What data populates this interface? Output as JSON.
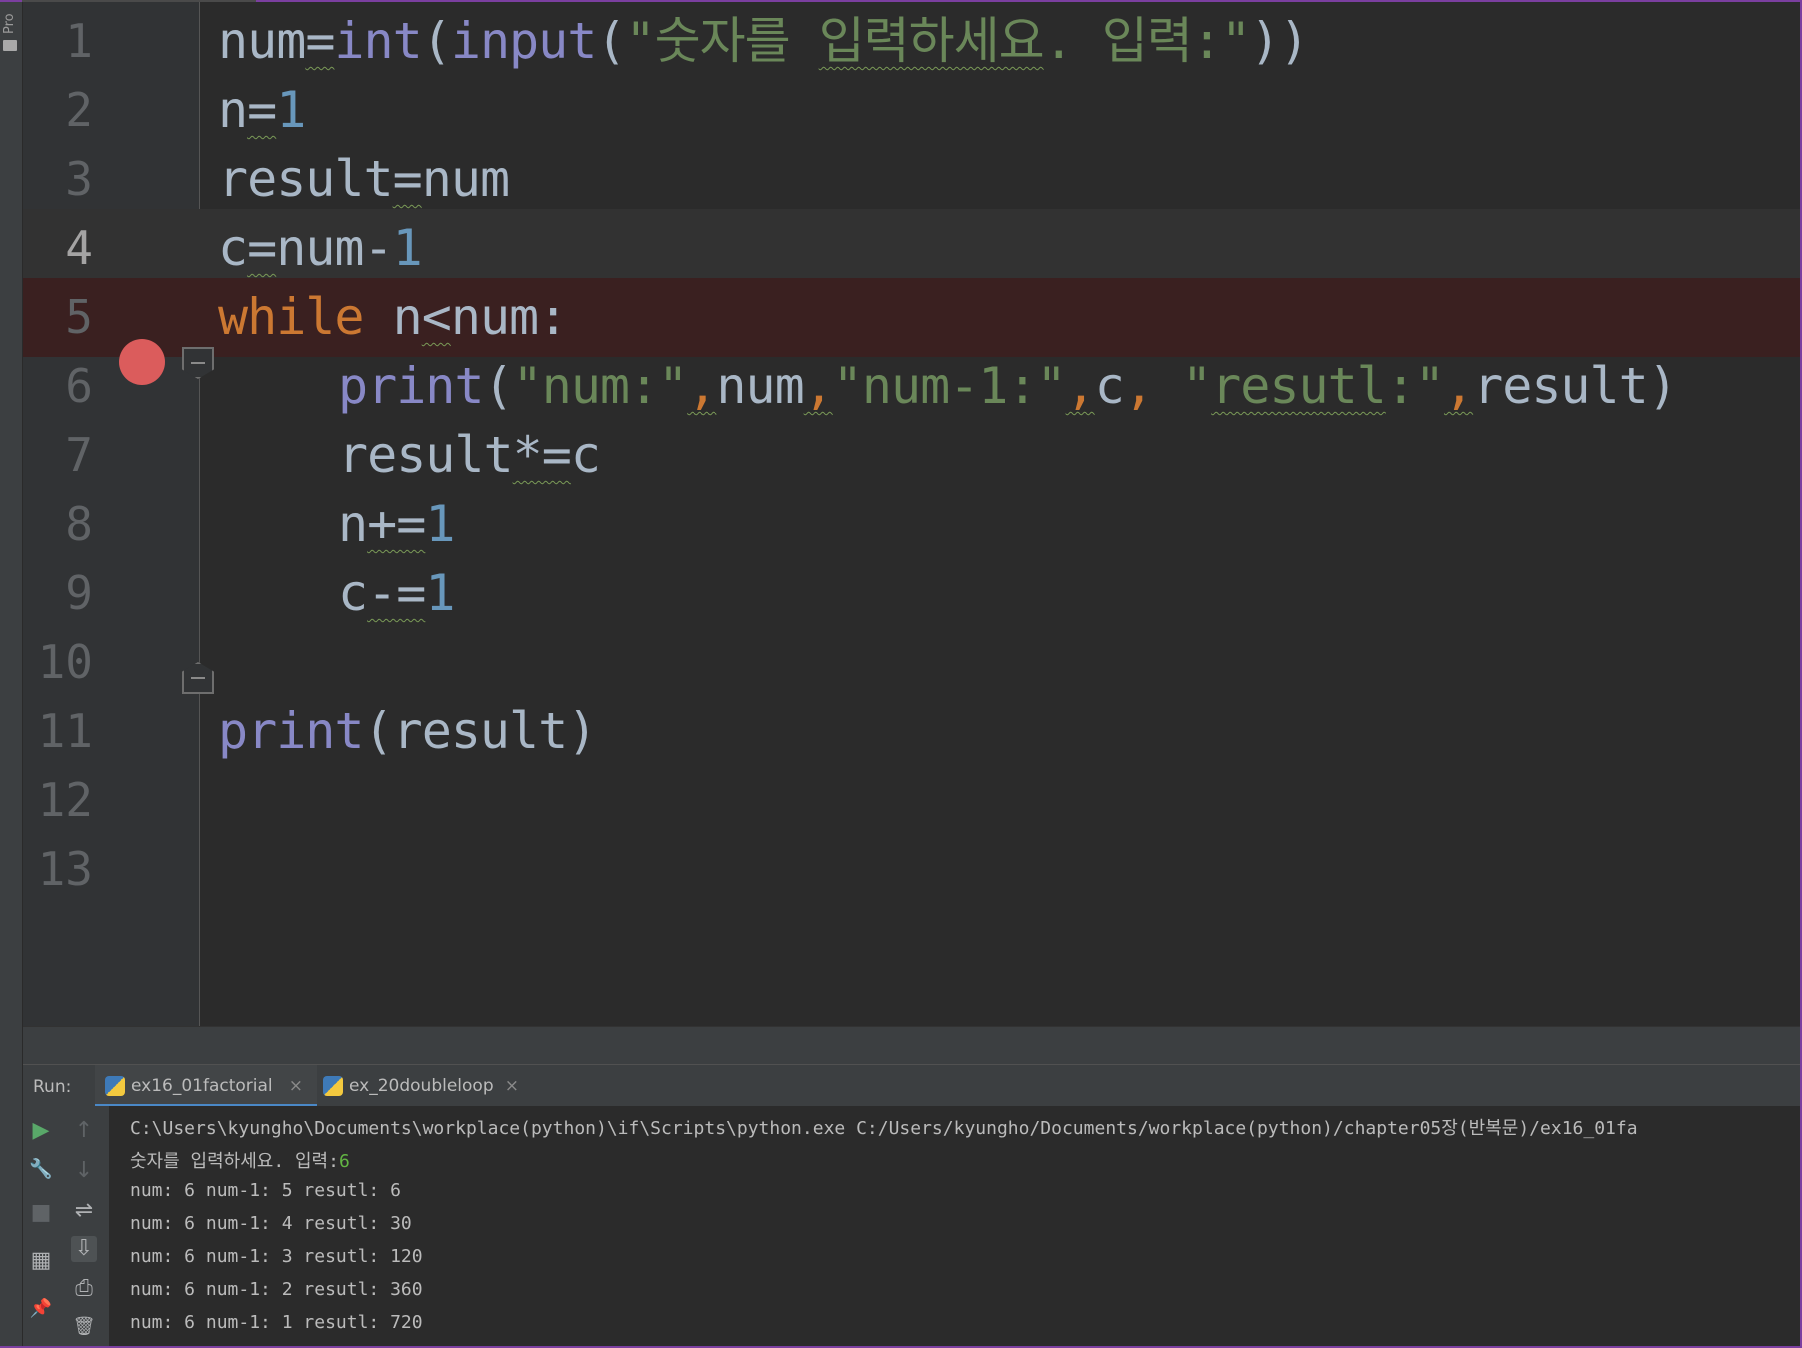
{
  "sidebar": {
    "project_label": "Pro"
  },
  "editor": {
    "lines": [
      {
        "n": "1"
      },
      {
        "n": "2"
      },
      {
        "n": "3"
      },
      {
        "n": "4"
      },
      {
        "n": "5"
      },
      {
        "n": "6"
      },
      {
        "n": "7"
      },
      {
        "n": "8"
      },
      {
        "n": "9"
      },
      {
        "n": "10"
      },
      {
        "n": "11"
      },
      {
        "n": "12"
      },
      {
        "n": "13"
      }
    ],
    "code": {
      "l1": {
        "a": "num",
        "b": "=",
        "c": "int",
        "d": "(",
        "e": "input",
        "f": "(",
        "g": "\"숫자를 ",
        "h": "입력하세요",
        "i": ". 입력:\"",
        "j": "))"
      },
      "l2": {
        "a": "n",
        "b": "=",
        "c": "1"
      },
      "l3": {
        "a": "result",
        "b": "=",
        "c": "num"
      },
      "l4": {
        "a": "c",
        "b": "=",
        "c": "num-",
        "d": "1"
      },
      "l5": {
        "a": "while",
        "b": " n",
        "c": "<",
        "d": "num:"
      },
      "l6": {
        "a": "print",
        "b": "(",
        "c": "\"num:\"",
        "d": ",",
        "e": "num",
        "f": ",",
        "g": "\"num-1:\"",
        "h": ",",
        "i": "c",
        "j": ", ",
        "k": "\"",
        "l": "resutl",
        "m": ":\"",
        "n": ",",
        "o": "result)"
      },
      "l7": {
        "a": "result",
        "b": "*=",
        "c": "c"
      },
      "l8": {
        "a": "n",
        "b": "+=",
        "c": "1"
      },
      "l9": {
        "a": "c",
        "b": "-=",
        "c": "1"
      },
      "l11": {
        "a": "print",
        "b": "(result)"
      }
    }
  },
  "run_panel": {
    "label": "Run:",
    "tabs": [
      {
        "label": "ex16_01factorial",
        "close": "×"
      },
      {
        "label": "ex_20doubleloop",
        "close": "×"
      }
    ],
    "console": {
      "command": "C:\\Users\\kyungho\\Documents\\workplace(python)\\if\\Scripts\\python.exe C:/Users/kyungho/Documents/workplace(python)/chapter05장(반복문)/ex16_01fa",
      "prompt": "숫자를 입력하세요. 입력:",
      "input_value": "6",
      "output_lines": [
        "num: 6 num-1: 5 resutl: 6",
        "num: 6 num-1: 4 resutl: 30",
        "num: 6 num-1: 3 resutl: 120",
        "num: 6 num-1: 2 resutl: 360",
        "num: 6 num-1: 1 resutl: 720"
      ]
    }
  },
  "toolbar": {
    "rerun_icon": "▶",
    "settings_icon": "🔧",
    "stop_icon": "■",
    "layout_icon": "▦",
    "pin_icon": "📌",
    "up_icon": "↑",
    "down_icon": "↓",
    "wrap_icon": "⇌",
    "scroll_end_icon": "⇩",
    "print_icon": "⎙",
    "trash_icon": "🗑"
  },
  "colors": {
    "accent": "#4a88c7",
    "breakpoint": "#db5c5c",
    "keyword": "#cc7832",
    "string": "#6a8759",
    "number": "#6897bb",
    "builtin": "#8888c6"
  }
}
